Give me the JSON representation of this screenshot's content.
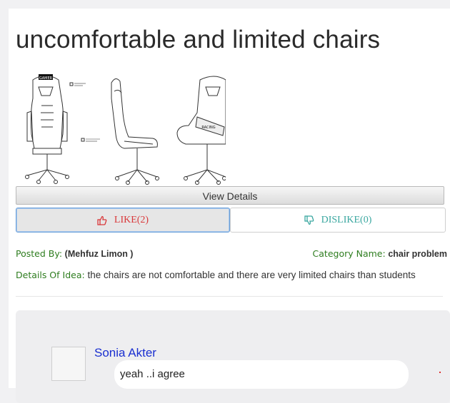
{
  "idea": {
    "title": "uncomfortable and limited chairs",
    "image_alt": "gaming chair line drawing",
    "chair_label_front": "GAMER",
    "chair_label_back": "RACING"
  },
  "actions": {
    "view_details_label": "View Details",
    "like_label": "LIKE(2)",
    "dislike_label": "DISLIKE(0)",
    "like_icon": "thumbs-up-icon",
    "dislike_icon": "thumbs-down-icon",
    "like_color": "#d9383a",
    "dislike_color": "#3aa7a0"
  },
  "meta": {
    "posted_by_label": "Posted By:",
    "posted_by_value": "(Mehfuz Limon )",
    "category_label": "Category Name:",
    "category_value": "chair problem",
    "details_label": "Details Of Idea:",
    "details_value": "the chairs are not comfortable and there are very limited chairs than students"
  },
  "comments": [
    {
      "author": "Sonia Akter",
      "text": "yeah ..i agree"
    }
  ]
}
